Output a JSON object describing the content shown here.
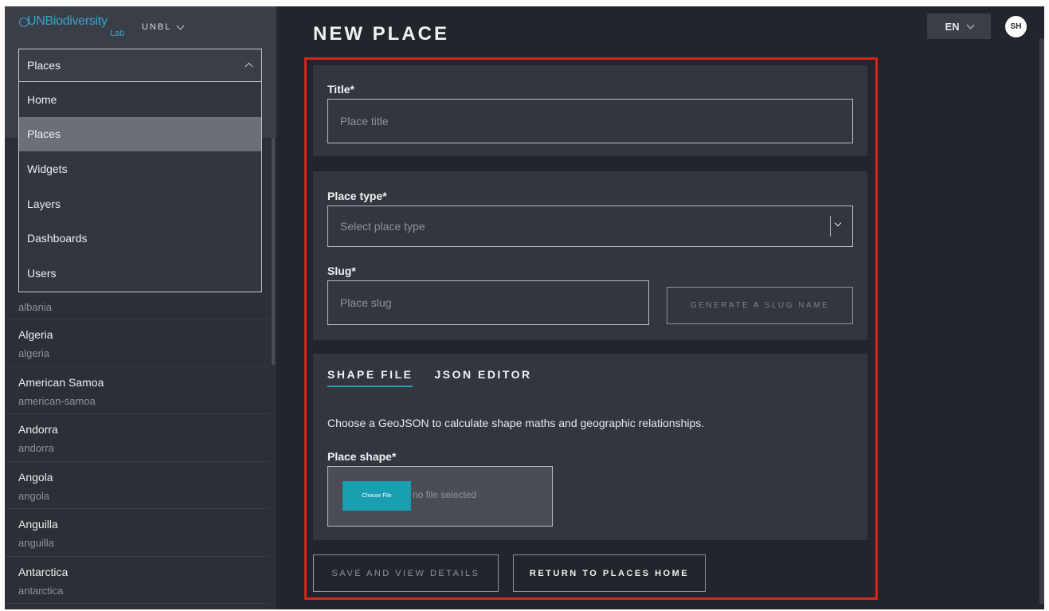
{
  "app": {
    "logo_main": "UNBiodiversity",
    "logo_sub": "Lab",
    "org_label": "UNBL"
  },
  "nav": {
    "section_selected": "Places",
    "menu_items": [
      {
        "label": "Home",
        "active": false
      },
      {
        "label": "Places",
        "active": true
      },
      {
        "label": "Widgets",
        "active": false
      },
      {
        "label": "Layers",
        "active": false
      },
      {
        "label": "Dashboards",
        "active": false
      },
      {
        "label": "Users",
        "active": false
      }
    ]
  },
  "places_list": [
    {
      "name": "",
      "slug": "albania"
    },
    {
      "name": "Algeria",
      "slug": "algeria"
    },
    {
      "name": "American Samoa",
      "slug": "american-samoa"
    },
    {
      "name": "Andorra",
      "slug": "andorra"
    },
    {
      "name": "Angola",
      "slug": "angola"
    },
    {
      "name": "Anguilla",
      "slug": "anguilla"
    },
    {
      "name": "Antarctica",
      "slug": "antarctica"
    }
  ],
  "header": {
    "page_title": "NEW PLACE",
    "language": "EN",
    "user_initials": "SH"
  },
  "form": {
    "title_label": "Title*",
    "title_placeholder": "Place title",
    "place_type_label": "Place type*",
    "place_type_placeholder": "Select place type",
    "slug_label": "Slug*",
    "slug_placeholder": "Place slug",
    "generate_slug_button": "GENERATE A SLUG NAME",
    "tabs": [
      {
        "label": "SHAPE FILE",
        "active": true
      },
      {
        "label": "JSON EDITOR",
        "active": false
      }
    ],
    "shape_help": "Choose a GeoJSON to calculate shape maths and geographic relationships.",
    "place_shape_label": "Place shape*",
    "choose_file_button": "Choose File",
    "file_status": "no file selected"
  },
  "actions": {
    "save_button": "SAVE AND VIEW DETAILS",
    "return_button": "RETURN TO PLACES HOME"
  },
  "colors": {
    "background": "#22252b",
    "card": "#33363e",
    "accent": "#1a9fb0",
    "highlight": "#d4261a"
  }
}
